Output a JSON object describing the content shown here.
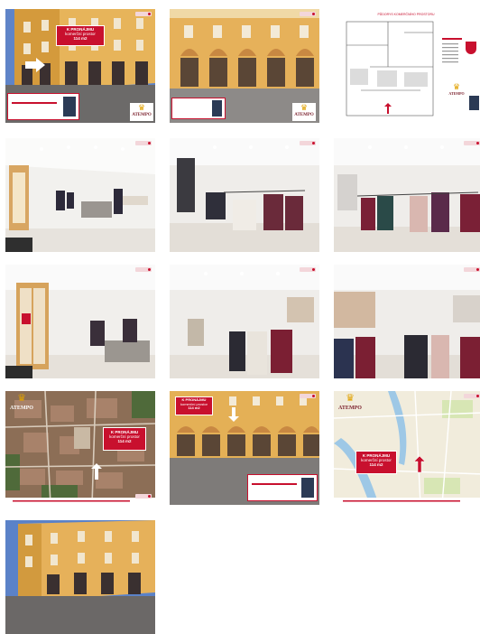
{
  "gallery": {
    "tiles": [
      {
        "id": "t1",
        "kind": "facade-agent",
        "banner_line1": "K PRONÁJMU",
        "banner_line2": "komerční prostor",
        "banner_line3": "114 m2"
      },
      {
        "id": "t2",
        "kind": "facade-close"
      },
      {
        "id": "t3",
        "kind": "floorplan",
        "plan_title": "PŮDORYS KOMERČNÍHO PROSTORU"
      },
      {
        "id": "t4",
        "kind": "interior"
      },
      {
        "id": "t5",
        "kind": "interior"
      },
      {
        "id": "t6",
        "kind": "interior"
      },
      {
        "id": "t7",
        "kind": "interior"
      },
      {
        "id": "t8",
        "kind": "interior"
      },
      {
        "id": "t9",
        "kind": "interior"
      },
      {
        "id": "t10",
        "kind": "map-aerial",
        "banner_line1": "K PRONÁJMU",
        "banner_line2": "komerční prostor",
        "banner_line3": "114 m2"
      },
      {
        "id": "t11",
        "kind": "facade-banner",
        "banner_line1": "K PRONÁJMU",
        "banner_line2": "komerční prostor",
        "banner_line3": "114 m2"
      },
      {
        "id": "t12",
        "kind": "map-street",
        "banner_line1": "K PRONÁJMU",
        "banner_line2": "komerční prostor",
        "banner_line3": "114 m2"
      },
      {
        "id": "t13",
        "kind": "facade-plain"
      }
    ]
  },
  "brand": {
    "name": "ATEMPO",
    "accent": "#c8102e",
    "crown_color": "#e0a100"
  }
}
